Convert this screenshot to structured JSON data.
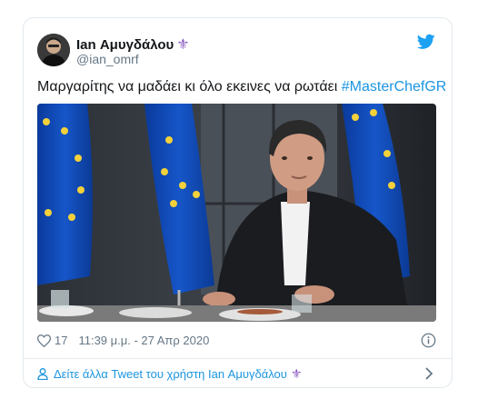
{
  "tweet": {
    "display_name": "Ian Αμυγδάλου",
    "name_emoji": "⚜",
    "handle": "@ian_omrf",
    "text": "Μαργαρίτης να μαδάει κι όλο εκεινες να ρωτάει ",
    "hashtag": "#MasterChefGR",
    "like_count": "17",
    "timestamp": "11:39 μ.μ. - 27 Απρ 2020",
    "more_link": "Δείτε άλλα Tweet του χρήστη Ian Αμυγδάλου",
    "more_link_emoji": "⚜"
  },
  "icons": {
    "brand": "twitter-bird-icon",
    "like": "heart-icon",
    "info": "info-icon",
    "user": "user-icon",
    "chevron": "chevron-right-icon"
  },
  "colors": {
    "link": "#1b95e0",
    "muted": "#657786",
    "border": "#e1e8ed",
    "brand_blue": "#1da1f2",
    "emoji_purple": "#8a5cc0"
  }
}
